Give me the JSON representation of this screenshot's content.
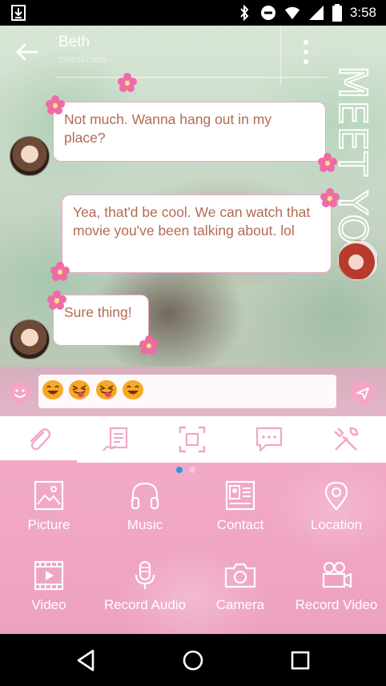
{
  "status_bar": {
    "time": "3:58",
    "icons": [
      "download-icon",
      "bluetooth-icon",
      "do-not-disturb-icon",
      "wifi-icon",
      "signal-icon",
      "battery-icon"
    ]
  },
  "header": {
    "contact_name": "Beth",
    "contact_number": "15663473816",
    "theme_text": "MEET YOU"
  },
  "messages": [
    {
      "direction": "incoming",
      "text": "Not much. Wanna hang out in my place?"
    },
    {
      "direction": "outgoing",
      "text": "Yea, that'd be cool. We can watch that movie you've been talking about. lol"
    },
    {
      "direction": "incoming",
      "text": "Sure thing!"
    }
  ],
  "composer": {
    "emoji_content": [
      "grinning-face",
      "squinting-face-with-tongue",
      "squinting-face-with-tongue",
      "grinning-face"
    ]
  },
  "tool_tabs": [
    {
      "icon": "paperclip-icon",
      "active": true
    },
    {
      "icon": "signature-icon",
      "active": false
    },
    {
      "icon": "screenshot-icon",
      "active": false
    },
    {
      "icon": "quick-reply-icon",
      "active": false
    },
    {
      "icon": "tools-icon",
      "active": false
    }
  ],
  "attachments": [
    {
      "label": "Picture",
      "icon": "picture-icon"
    },
    {
      "label": "Music",
      "icon": "headphones-icon"
    },
    {
      "label": "Contact",
      "icon": "contact-card-icon"
    },
    {
      "label": "Location",
      "icon": "location-pin-icon"
    },
    {
      "label": "Video",
      "icon": "video-icon"
    },
    {
      "label": "Record Audio",
      "icon": "microphone-icon"
    },
    {
      "label": "Camera",
      "icon": "camera-icon"
    },
    {
      "label": "Record Video",
      "icon": "video-camera-icon"
    }
  ],
  "pager": {
    "pages": 2,
    "current": 1
  },
  "colors": {
    "accent_pink": "#f3a6c7",
    "bubble_text": "#b36a53",
    "bubble_border": "#e9a9c6",
    "pager_active": "#2a9ad8"
  }
}
